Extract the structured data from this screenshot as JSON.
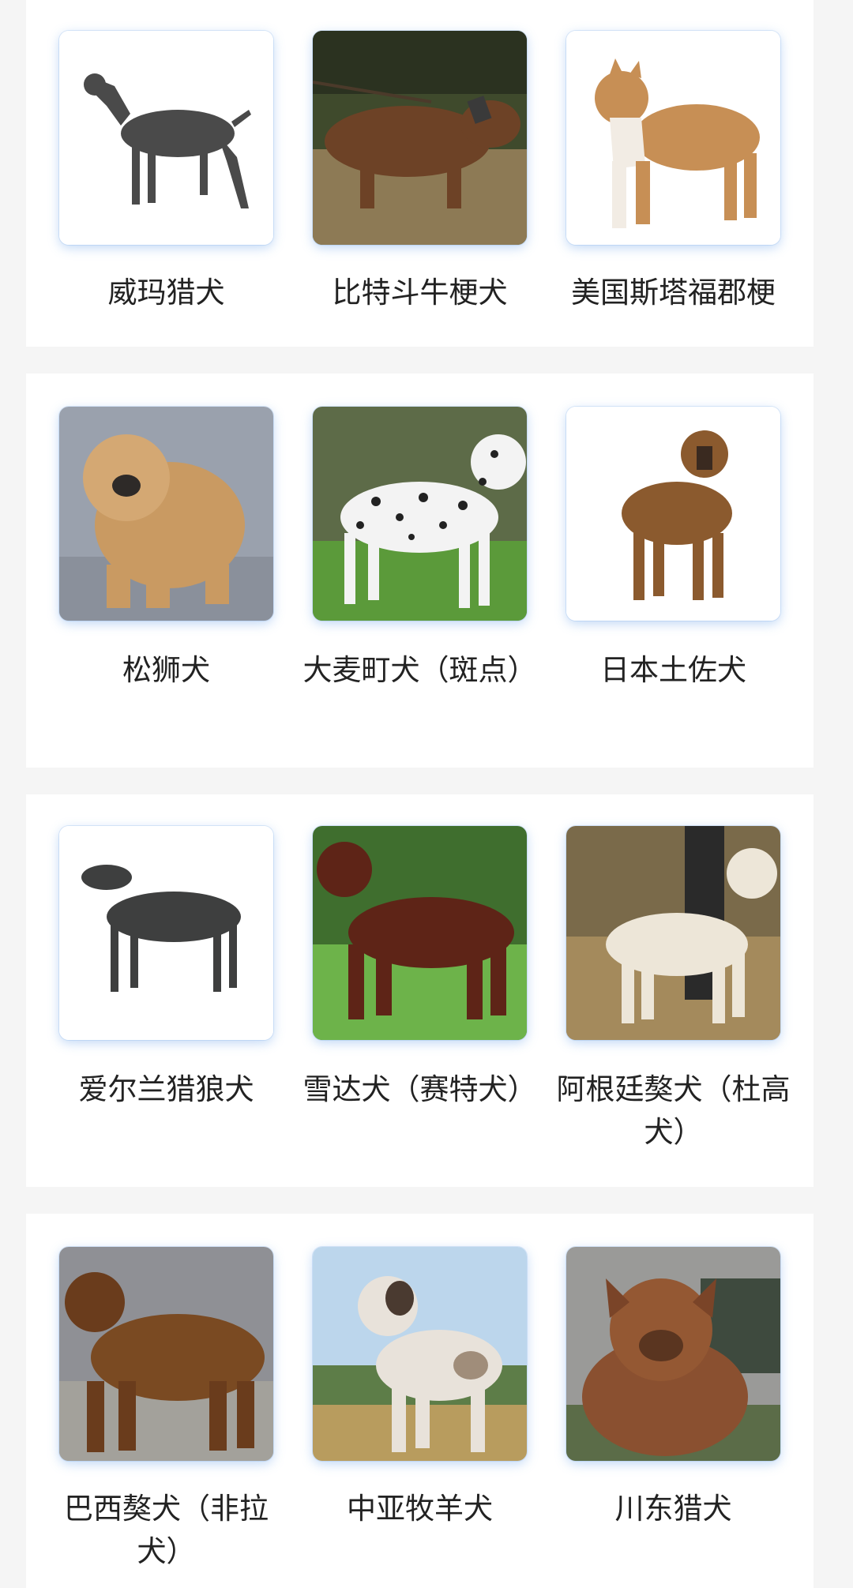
{
  "cards": [
    {
      "items": [
        {
          "name": "威玛猎犬",
          "image": "weimaraner-photo"
        },
        {
          "name": "比特斗牛梗犬",
          "image": "pit-bull-terrier-photo"
        },
        {
          "name": "美国斯塔福郡梗",
          "image": "american-staffordshire-terrier-photo"
        }
      ]
    },
    {
      "items": [
        {
          "name": "松狮犬",
          "image": "chow-chow-photo"
        },
        {
          "name": "大麦町犬（斑点）",
          "image": "dalmatian-photo"
        },
        {
          "name": "日本土佐犬",
          "image": "tosa-inu-photo"
        }
      ]
    },
    {
      "items": [
        {
          "name": "爱尔兰猎狼犬",
          "image": "irish-wolfhound-photo"
        },
        {
          "name": "雪达犬（赛特犬）",
          "image": "irish-setter-photo"
        },
        {
          "name": "阿根廷獒犬（杜高犬）",
          "image": "dogo-argentino-photo"
        }
      ]
    },
    {
      "items": [
        {
          "name": "巴西獒犬（非拉犬）",
          "image": "fila-brasileiro-photo"
        },
        {
          "name": "中亚牧羊犬",
          "image": "central-asian-shepherd-photo"
        },
        {
          "name": "川东猎犬",
          "image": "chuandong-hound-photo"
        }
      ]
    }
  ],
  "colors": {
    "page_bg": "#f5f5f5",
    "card_bg": "#ffffff",
    "label_text": "#222222",
    "thumb_glow": "#9cc3f0"
  }
}
